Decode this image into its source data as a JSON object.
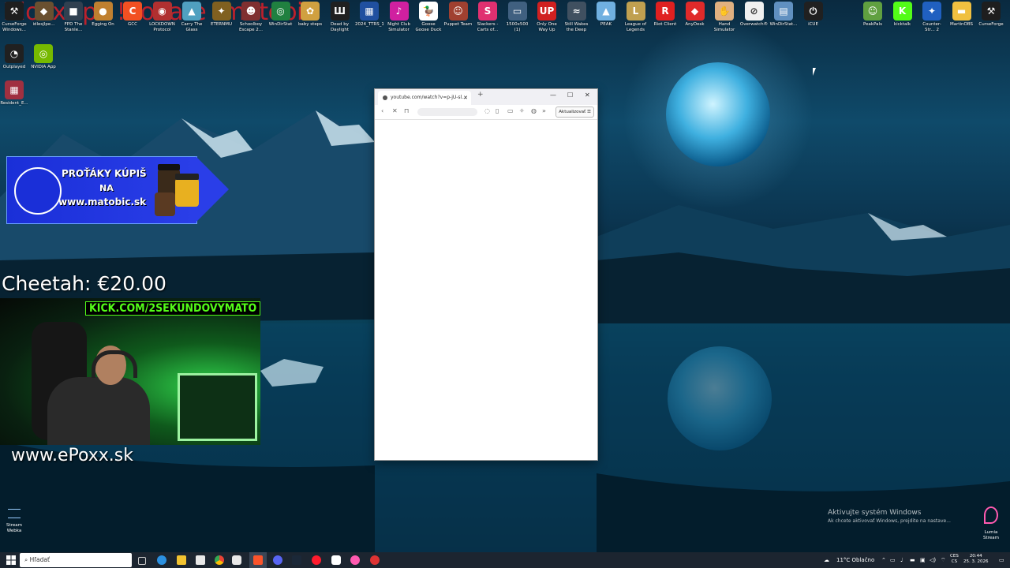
{
  "overlay": {
    "title": "!doxx !pc !donate !matobic",
    "donation": "Cheetah: €20.00",
    "kick": "KICK.COM/2SEKUNDOVYMATO",
    "site": "www.ePoxx.sk"
  },
  "banner": {
    "line1": "PROŤÁKY KÚPIŠ",
    "line2": "NA",
    "line3": "www.matobic.sk"
  },
  "desktop_icons": [
    {
      "label": "CurseForge Windows...",
      "color": "#ffffff",
      "bg": "#1e1e1e",
      "glyph": "⚒"
    },
    {
      "label": "idlesjlpe...",
      "color": "#ffffff",
      "bg": "#6a5030",
      "glyph": "◆"
    },
    {
      "label": "FPD The Stanle...",
      "color": "#ffffff",
      "bg": "#304050",
      "glyph": "■"
    },
    {
      "label": "Egging On",
      "color": "#ffffff",
      "bg": "#c08030",
      "glyph": "●"
    },
    {
      "label": "GCC",
      "color": "#ffffff",
      "bg": "#f25022",
      "glyph": "C"
    },
    {
      "label": "LOCKDOWN Protocol",
      "color": "#ffffff",
      "bg": "#b03030",
      "glyph": "◉"
    },
    {
      "label": "Carry The Glass",
      "color": "#ffffff",
      "bg": "#50a0c0",
      "glyph": "▲"
    },
    {
      "label": "ETERNMU",
      "color": "#ffffff",
      "bg": "#806020",
      "glyph": "✦"
    },
    {
      "label": "Schoolboy Escape 2...",
      "color": "#ffffff",
      "bg": "#803030",
      "glyph": "☻"
    },
    {
      "label": "WinDirStat",
      "color": "#ffffff",
      "bg": "#208040",
      "glyph": "◎"
    },
    {
      "label": "baby steps",
      "color": "#ffffff",
      "bg": "#d0a040",
      "glyph": "✿"
    },
    {
      "label": "Dead by Daylight",
      "color": "#ffffff",
      "bg": "#202020",
      "glyph": "Ш"
    },
    {
      "label": "2024_TTRS_1",
      "color": "#ffffff",
      "bg": "#2050a0",
      "glyph": "▦"
    },
    {
      "label": "Night Club Simulator",
      "color": "#ffffff",
      "bg": "#d020a0",
      "glyph": "♪"
    },
    {
      "label": "Goose Goose Duck",
      "color": "#ffffff",
      "bg": "#ffffff",
      "glyph": "🦆"
    },
    {
      "label": "Puppet Team",
      "color": "#ffffff",
      "bg": "#a04030",
      "glyph": "☺"
    },
    {
      "label": "Slackers - Carts of...",
      "color": "#ffffff",
      "bg": "#e03070",
      "glyph": "S"
    },
    {
      "label": "1500x500 (1)",
      "color": "#ffffff",
      "bg": "#406080",
      "glyph": "▭"
    },
    {
      "label": "Only One Way Up",
      "color": "#ffffff",
      "bg": "#d02020",
      "glyph": "UP"
    },
    {
      "label": "Still Wakes the Deep",
      "color": "#ffffff",
      "bg": "#405060",
      "glyph": "≈"
    },
    {
      "label": "PEAK",
      "color": "#ffffff",
      "bg": "#70b0e0",
      "glyph": "▲"
    },
    {
      "label": "League of Legends",
      "color": "#ffffff",
      "bg": "#c0a050",
      "glyph": "L"
    },
    {
      "label": "Riot Client",
      "color": "#ffffff",
      "bg": "#e02020",
      "glyph": "R"
    },
    {
      "label": "AnyDesk",
      "color": "#ffffff",
      "bg": "#e02a2a",
      "glyph": "◆"
    },
    {
      "label": "Hand Simulator",
      "color": "#ffffff",
      "bg": "#e0b080",
      "glyph": "✋"
    },
    {
      "label": "Overwatch®",
      "color": "#ffffff",
      "bg": "#f0f0f0",
      "glyph": "⊘"
    },
    {
      "label": "WinDirStat...",
      "color": "#ffffff",
      "bg": "#6090c0",
      "glyph": "▤"
    },
    {
      "label": "iCUE",
      "color": "#ffffff",
      "bg": "#202020",
      "glyph": "⏻"
    },
    {
      "label": "PeakPals",
      "color": "#ffffff",
      "bg": "#60a040",
      "glyph": "☺"
    },
    {
      "label": "kicktalk",
      "color": "#ffffff",
      "bg": "#53fc18",
      "glyph": "K"
    },
    {
      "label": "Counter-Str... 2",
      "color": "#ffffff",
      "bg": "#2060c0",
      "glyph": "✦"
    },
    {
      "label": "MartinOBS",
      "color": "#ffffff",
      "bg": "#f0c040",
      "glyph": "▬"
    },
    {
      "label": "CurseForge",
      "color": "#ffffff",
      "bg": "#1e1e1e",
      "glyph": "⚒"
    }
  ],
  "left_icons": [
    {
      "label": "Outplayed",
      "bg": "#202020",
      "glyph": "◔"
    },
    {
      "label": "NVIDIA App",
      "bg": "#76b900",
      "glyph": "◎"
    },
    {
      "label": "Resident_E...",
      "bg": "#a03040",
      "glyph": "▦"
    }
  ],
  "browser": {
    "tab_title": "youtube.com/watch?v=p-jU-sl...",
    "update_label": "Aktualizovať"
  },
  "activation": {
    "line1": "Aktivujte systém Windows",
    "line2": "Ak chcete aktivovať Windows, prejdite na nastave..."
  },
  "stream_webka": "Stream Webka",
  "lumia": "Lumia Stream",
  "taskbar": {
    "search_placeholder": "Hľadať",
    "weather": "11°C  Oblačno",
    "lang": "CES",
    "lang2": "CS",
    "time": "20:44",
    "date": "25. 3. 2026"
  },
  "colors": {
    "kick_green": "#53fc18",
    "donation_red": "#d0202a",
    "banner_blue": "#1a2fd8"
  }
}
